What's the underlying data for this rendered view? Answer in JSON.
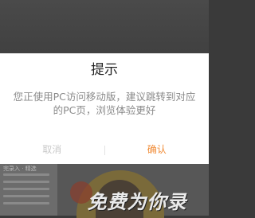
{
  "dialog": {
    "title": "提示",
    "message_line1": "您正使用PC访问移动版，建议跳转到对应",
    "message_line2": "的PC页，浏览体验更好",
    "cancel_label": "取消",
    "confirm_label": "确认"
  },
  "background": {
    "promo_text": "免费为你录",
    "small_text": "完录入 · 精选"
  },
  "colors": {
    "confirm": "#f08a34",
    "cancel": "#c9c9c9",
    "overlay": "#3a3a3a"
  }
}
